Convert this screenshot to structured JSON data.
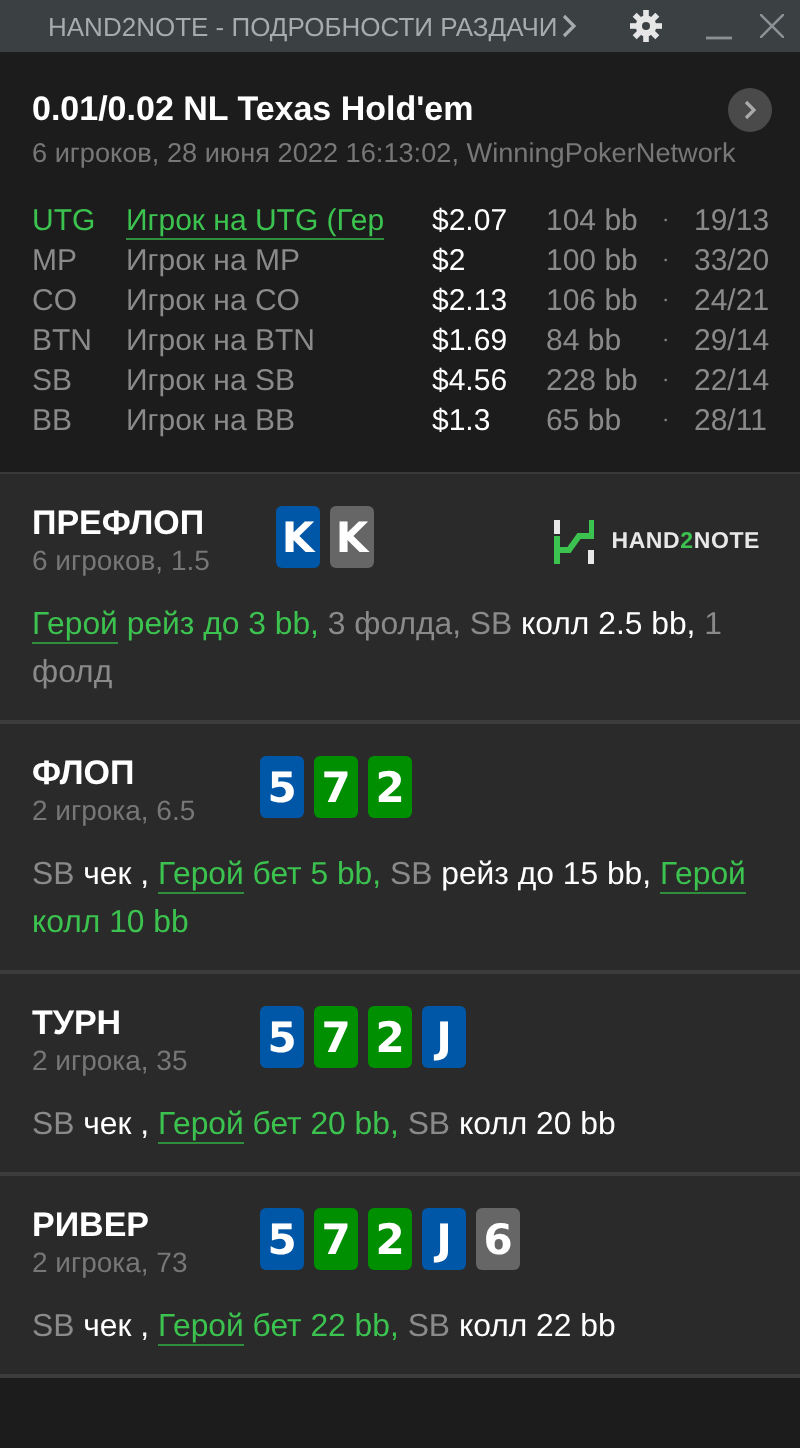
{
  "window": {
    "title": "HAND2NOTE - ПОДРОБНОСТИ РАЗДАЧИ"
  },
  "hand": {
    "title": "0.01/0.02 NL Texas Hold'em",
    "subtitle": "6 игроков, 28 июня 2022 16:13:02, WinningPokerNetwork"
  },
  "players": [
    {
      "position": "UTG",
      "name": "Игрок на UTG (Гер",
      "stack": "$2.07",
      "bb": "104 bb",
      "separator": "·",
      "stats": "19/13",
      "hero": true
    },
    {
      "position": "MP",
      "name": "Игрок на MP",
      "stack": "$2",
      "bb": "100 bb",
      "separator": "·",
      "stats": "33/20",
      "hero": false
    },
    {
      "position": "CO",
      "name": "Игрок на CO",
      "stack": "$2.13",
      "bb": "106 bb",
      "separator": "·",
      "stats": "24/21",
      "hero": false
    },
    {
      "position": "BTN",
      "name": "Игрок на BTN",
      "stack": "$1.69",
      "bb": "84 bb",
      "separator": "·",
      "stats": "29/14",
      "hero": false
    },
    {
      "position": "SB",
      "name": "Игрок на SB",
      "stack": "$4.56",
      "bb": "228 bb",
      "separator": "·",
      "stats": "22/14",
      "hero": false
    },
    {
      "position": "BB",
      "name": "Игрок на BB",
      "stack": "$1.3",
      "bb": "65 bb",
      "separator": "·",
      "stats": "28/11",
      "hero": false
    }
  ],
  "streets": [
    {
      "name": "ПРЕФЛОП",
      "info": "6 игроков, 1.5",
      "logo": [
        "HAND",
        "2",
        "NOTE"
      ],
      "cards": [
        {
          "rank": "K",
          "color": "#0057a8"
        },
        {
          "rank": "K",
          "color": "#666666"
        }
      ],
      "actions": [
        {
          "kind": "hero-link",
          "text": "Герой"
        },
        {
          "kind": "hero",
          "text": " рейз до 3 bb,"
        },
        {
          "kind": "muted",
          "text": " 3 фолда, SB"
        },
        {
          "kind": "action",
          "text": " колл 2.5 bb,"
        },
        {
          "kind": "muted",
          "text": " 1 фолд"
        }
      ]
    },
    {
      "name": "ФЛОП",
      "info": "2 игрока, 6.5",
      "cards": [
        {
          "rank": "5",
          "color": "#0057a8"
        },
        {
          "rank": "7",
          "color": "#008f00"
        },
        {
          "rank": "2",
          "color": "#008f00"
        }
      ],
      "actions": [
        {
          "kind": "muted",
          "text": "SB"
        },
        {
          "kind": "action",
          "text": " чек , "
        },
        {
          "kind": "hero-link",
          "text": "Герой"
        },
        {
          "kind": "hero",
          "text": " бет 5 bb,"
        },
        {
          "kind": "muted",
          "text": " SB"
        },
        {
          "kind": "action",
          "text": " рейз до 15 bb, "
        },
        {
          "kind": "hero-link",
          "text": "Герой"
        },
        {
          "kind": "hero",
          "text": " колл 10 bb"
        }
      ]
    },
    {
      "name": "ТУРН",
      "info": "2 игрока, 35",
      "cards": [
        {
          "rank": "5",
          "color": "#0057a8"
        },
        {
          "rank": "7",
          "color": "#008f00"
        },
        {
          "rank": "2",
          "color": "#008f00"
        },
        {
          "rank": "J",
          "color": "#0057a8"
        }
      ],
      "actions": [
        {
          "kind": "muted",
          "text": "SB"
        },
        {
          "kind": "action",
          "text": " чек , "
        },
        {
          "kind": "hero-link",
          "text": "Герой"
        },
        {
          "kind": "hero",
          "text": " бет 20 bb,"
        },
        {
          "kind": "muted",
          "text": " SB"
        },
        {
          "kind": "action",
          "text": " колл 20 bb"
        }
      ]
    },
    {
      "name": "РИВЕР",
      "info": "2 игрока, 73",
      "cards": [
        {
          "rank": "5",
          "color": "#0057a8"
        },
        {
          "rank": "7",
          "color": "#008f00"
        },
        {
          "rank": "2",
          "color": "#008f00"
        },
        {
          "rank": "J",
          "color": "#0057a8"
        },
        {
          "rank": "6",
          "color": "#666666"
        }
      ],
      "actions": [
        {
          "kind": "muted",
          "text": "SB"
        },
        {
          "kind": "action",
          "text": " чек , "
        },
        {
          "kind": "hero-link",
          "text": "Герой"
        },
        {
          "kind": "hero",
          "text": " бет 22 bb,"
        },
        {
          "kind": "muted",
          "text": " SB"
        },
        {
          "kind": "action",
          "text": " колл 22 bb"
        }
      ]
    }
  ]
}
